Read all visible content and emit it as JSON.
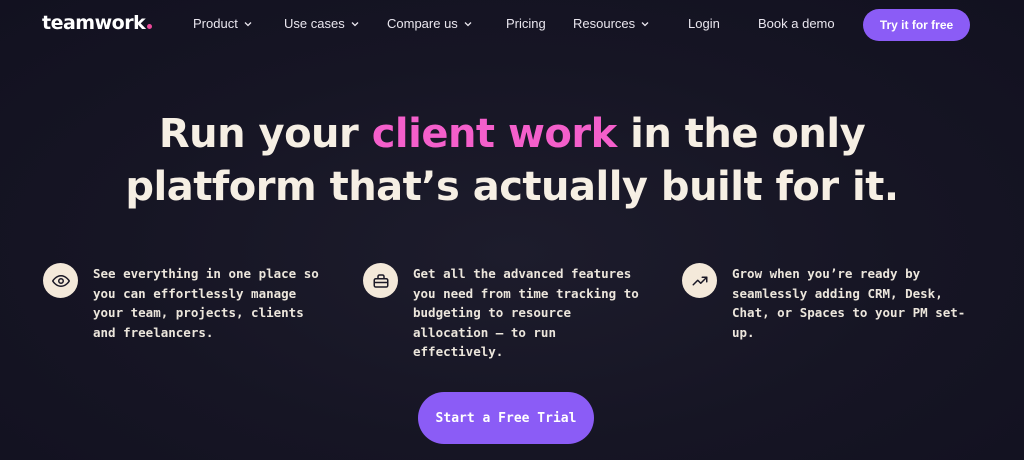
{
  "colors": {
    "background": "#14131f",
    "accent_purple": "#8b5cf6",
    "highlight_pink": "#f45fcb",
    "logo_dot": "#ec4899",
    "icon_bg": "#f4e9da"
  },
  "nav": {
    "logo": "teamwork",
    "items": [
      {
        "label": "Product",
        "dropdown": true
      },
      {
        "label": "Use cases",
        "dropdown": true
      },
      {
        "label": "Compare us",
        "dropdown": true
      },
      {
        "label": "Pricing",
        "dropdown": false
      },
      {
        "label": "Resources",
        "dropdown": true
      }
    ],
    "login": "Login",
    "book_demo": "Book a demo",
    "cta": "Try it for free"
  },
  "hero": {
    "headline_part1": "Run your ",
    "headline_highlight": "client work",
    "headline_part2": " in the only",
    "headline_line2": "platform that’s actually built for it."
  },
  "features": [
    {
      "icon": "eye-icon",
      "text": "See everything in one place so you can effortlessly manage your team, projects, clients and freelancers."
    },
    {
      "icon": "briefcase-icon",
      "text": "Get all the advanced features you need from time tracking to budgeting to resource allocation — to run effectively."
    },
    {
      "icon": "trending-up-icon",
      "text": "Grow when you’re ready by seamlessly adding CRM, Desk, Chat, or Spaces to your PM set-up."
    }
  ],
  "cta_main": "Start a Free Trial"
}
